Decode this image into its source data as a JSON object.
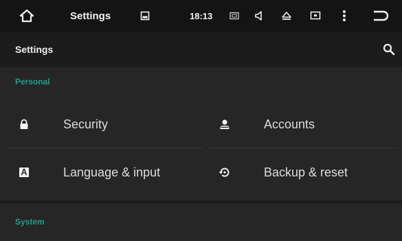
{
  "status_bar": {
    "title": "Settings",
    "time": "18:13",
    "icons": [
      "home-icon",
      "image-icon",
      "sim-icon",
      "volume-icon",
      "eject-icon",
      "screen-icon",
      "more-vert-icon",
      "back-icon"
    ]
  },
  "app_bar": {
    "title": "Settings",
    "search_icon": "search-icon"
  },
  "sections": {
    "personal": {
      "header": "Personal",
      "items": [
        {
          "label": "Security",
          "icon": "lock-icon"
        },
        {
          "label": "Accounts",
          "icon": "account-icon"
        },
        {
          "label": "Language & input",
          "icon": "keyboard-language-icon"
        },
        {
          "label": "Backup & reset",
          "icon": "backup-restore-icon"
        }
      ]
    },
    "system": {
      "header": "System"
    }
  },
  "colors": {
    "accent": "#1e9e8c",
    "status_bar_bg": "#141414",
    "app_bar_bg": "#1c1c1c",
    "content_bg": "#262626"
  }
}
